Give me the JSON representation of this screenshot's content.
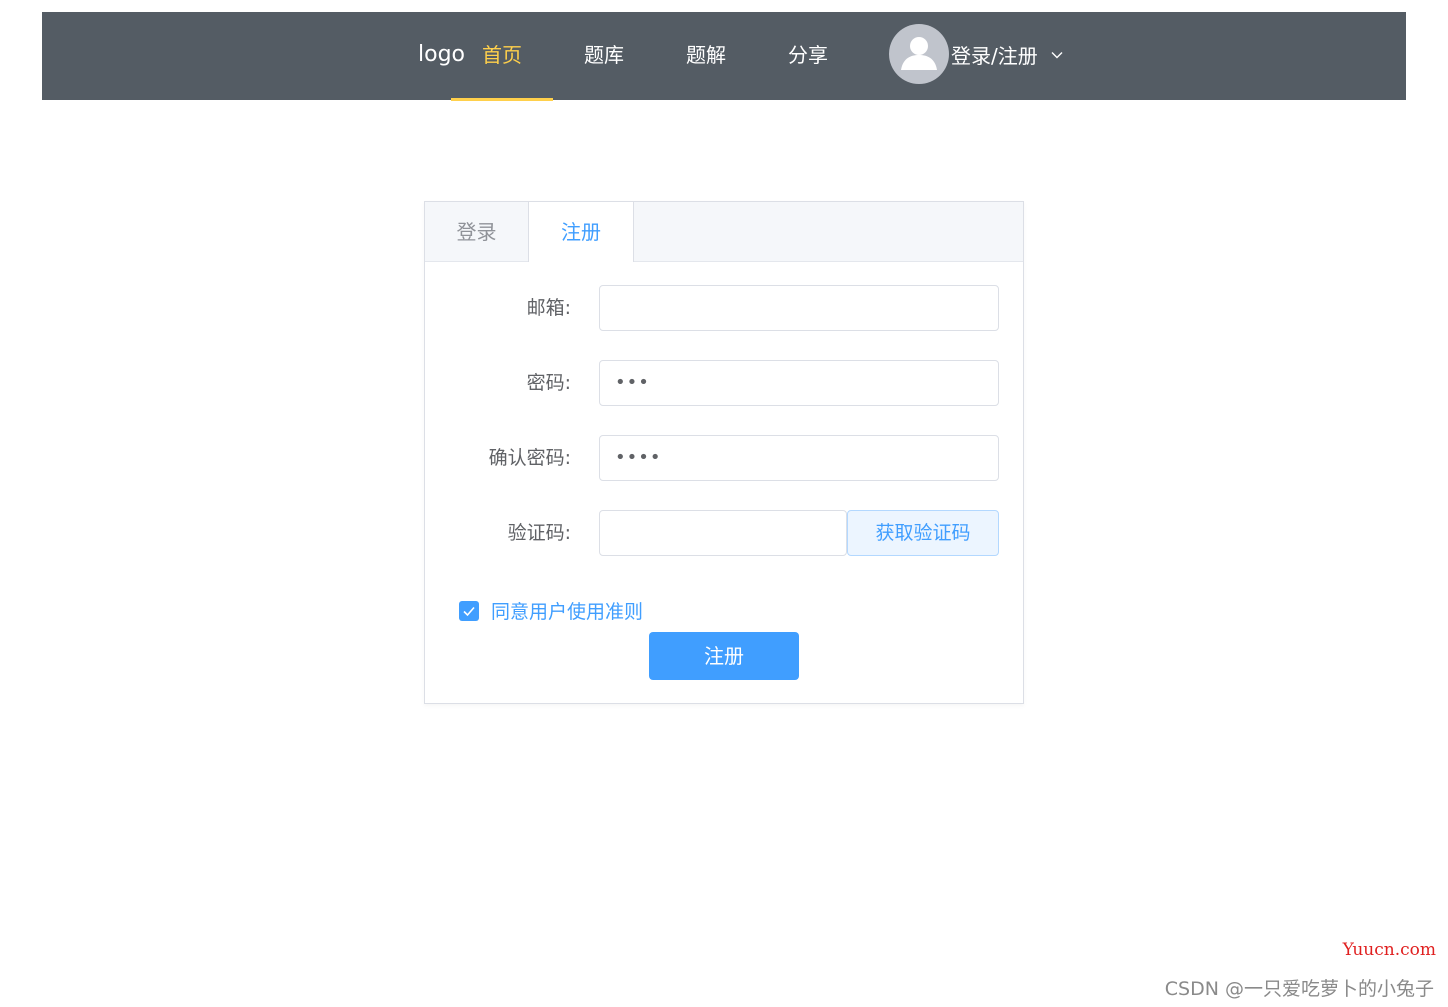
{
  "nav": {
    "logo": "logo",
    "items": [
      {
        "label": "首页",
        "active": true
      },
      {
        "label": "题库",
        "active": false
      },
      {
        "label": "题解",
        "active": false
      },
      {
        "label": "分享",
        "active": false
      }
    ],
    "user_label": "登录/注册",
    "active_color": "#ffd04b",
    "background_color": "#545c64"
  },
  "auth": {
    "tabs": [
      {
        "label": "登录",
        "active": false
      },
      {
        "label": "注册",
        "active": true
      }
    ],
    "fields": {
      "email": {
        "label": "邮箱:",
        "value": ""
      },
      "password": {
        "label": "密码:",
        "value": "•••"
      },
      "confirm": {
        "label": "确认密码:",
        "value": "••••"
      },
      "code": {
        "label": "验证码:",
        "value": "",
        "button": "获取验证码"
      }
    },
    "agree": {
      "label": "同意用户使用准则",
      "checked": true
    },
    "submit": "注册",
    "accent_color": "#409eff"
  },
  "watermark": {
    "site": "Yuucn.com",
    "csdn": "CSDN @一只爱吃萝卜的小兔子"
  }
}
